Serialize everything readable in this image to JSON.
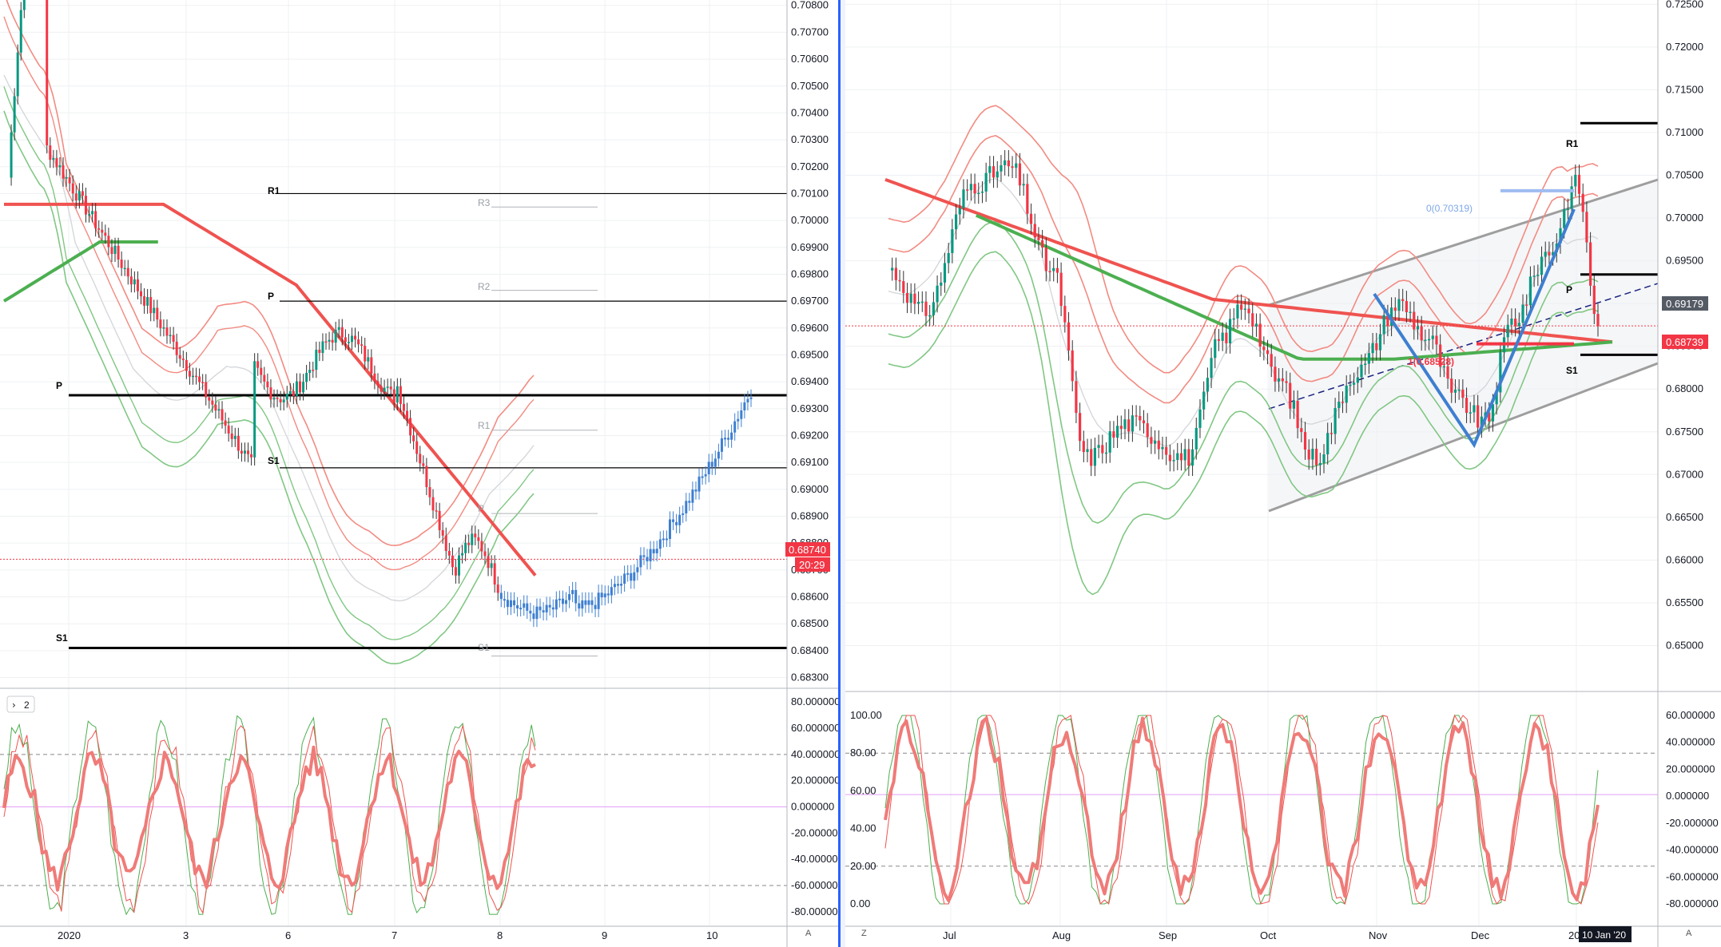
{
  "colors": {
    "up": "#089981",
    "down": "#f23645",
    "sma_red": "#ef5350",
    "sma_green": "#4caf50",
    "band_red": "#f28b82",
    "band_green": "#81c784",
    "blue": "#3e7fd0",
    "grid": "#eef0f3",
    "divider": "#2962ff"
  },
  "left": {
    "price_axis": [
      "0.70800",
      "0.70700",
      "0.70600",
      "0.70500",
      "0.70400",
      "0.70300",
      "0.70200",
      "0.70100",
      "0.70000",
      "0.69900",
      "0.69800",
      "0.69700",
      "0.69600",
      "0.69500",
      "0.69400",
      "0.69300",
      "0.69200",
      "0.69100",
      "0.69000",
      "0.68900",
      "0.68800",
      "0.68700",
      "0.68600",
      "0.68500",
      "0.68400",
      "0.68300"
    ],
    "last_price_badge": "0.68740",
    "countdown_badge": "20:29",
    "pivot_daily": {
      "R1": "R1",
      "P": "P",
      "S1": "S1"
    },
    "pivot_weekly": {
      "R3": "R3",
      "R2": "R2",
      "R1": "R1",
      "P": "P",
      "S1": "S1"
    },
    "indicator_badge": "2",
    "osc_axis": [
      "80.000000",
      "60.000000",
      "40.000000",
      "20.000000",
      "0.000000",
      "-20.000000",
      "-40.000000",
      "-60.000000",
      "-80.000000"
    ],
    "time_axis": [
      "2020",
      "3",
      "6",
      "7",
      "8",
      "9",
      "10"
    ],
    "corner_label": "A"
  },
  "right": {
    "price_axis": [
      "0.72500",
      "0.72000",
      "0.71500",
      "0.71000",
      "0.70500",
      "0.70000",
      "0.69500",
      "0.69000",
      "0.68500",
      "0.68000",
      "0.67500",
      "0.67000",
      "0.66500",
      "0.66000",
      "0.65500",
      "0.65000"
    ],
    "badge_upper": "0.69179",
    "badge_lower": "0.68739",
    "pivot_tags": {
      "R1": "R1",
      "P": "P",
      "S1": "S1"
    },
    "fib_label_top": "0(0.70319)",
    "fib_label_mid": "1(0.68528)",
    "osc_axis_left": [
      "100.00",
      "80.00",
      "60.00",
      "40.00",
      "20.00",
      "0.00"
    ],
    "osc_axis_right": [
      "60.000000",
      "40.000000",
      "20.000000",
      "0.000000",
      "-20.000000",
      "-40.000000",
      "-60.000000",
      "-80.000000"
    ],
    "time_axis": [
      "Jul",
      "Aug",
      "Sep",
      "Oct",
      "Nov",
      "Dec",
      "20"
    ],
    "crosshair_date": "10 Jan '20",
    "corner_label_left": "Z",
    "corner_label_right": "A"
  },
  "chart_data": [
    {
      "type": "candlestick",
      "title": "",
      "timeframe_axis": [
        "2020",
        "3",
        "6",
        "7",
        "8",
        "9",
        "10"
      ],
      "ylim": [
        0.6826,
        0.7082
      ],
      "levels": {
        "R1": 0.701,
        "P": 0.697,
        "P_weekly": 0.6935,
        "S1": 0.6908,
        "S1_weekly": 0.6841,
        "R3": 0.7005,
        "R2": 0.6974,
        "R1_weekly": 0.6922,
        "P_weekly_proj": 0.6891,
        "S1_weekly_proj": 0.6838,
        "last": 0.6874
      }
    },
    {
      "type": "candlestick",
      "title": "",
      "x": [
        "Jul",
        "Aug",
        "Sep",
        "Oct",
        "Nov",
        "Dec",
        "20"
      ],
      "ylim": [
        0.645,
        0.7255
      ],
      "levels": {
        "R1": 0.7111,
        "P": 0.6934,
        "S1": 0.684,
        "last": 0.68739,
        "badge": 0.69179,
        "fib_0": 0.70319,
        "fib_1": 0.68528
      }
    },
    {
      "type": "line",
      "title": "",
      "name": "oscillator_left",
      "ylim": [
        -85,
        85
      ],
      "levels": [
        40,
        0,
        -60
      ]
    },
    {
      "type": "line",
      "title": "",
      "name": "oscillator_right",
      "ylim": [
        -85,
        70
      ],
      "levels": [
        80,
        20
      ]
    }
  ]
}
